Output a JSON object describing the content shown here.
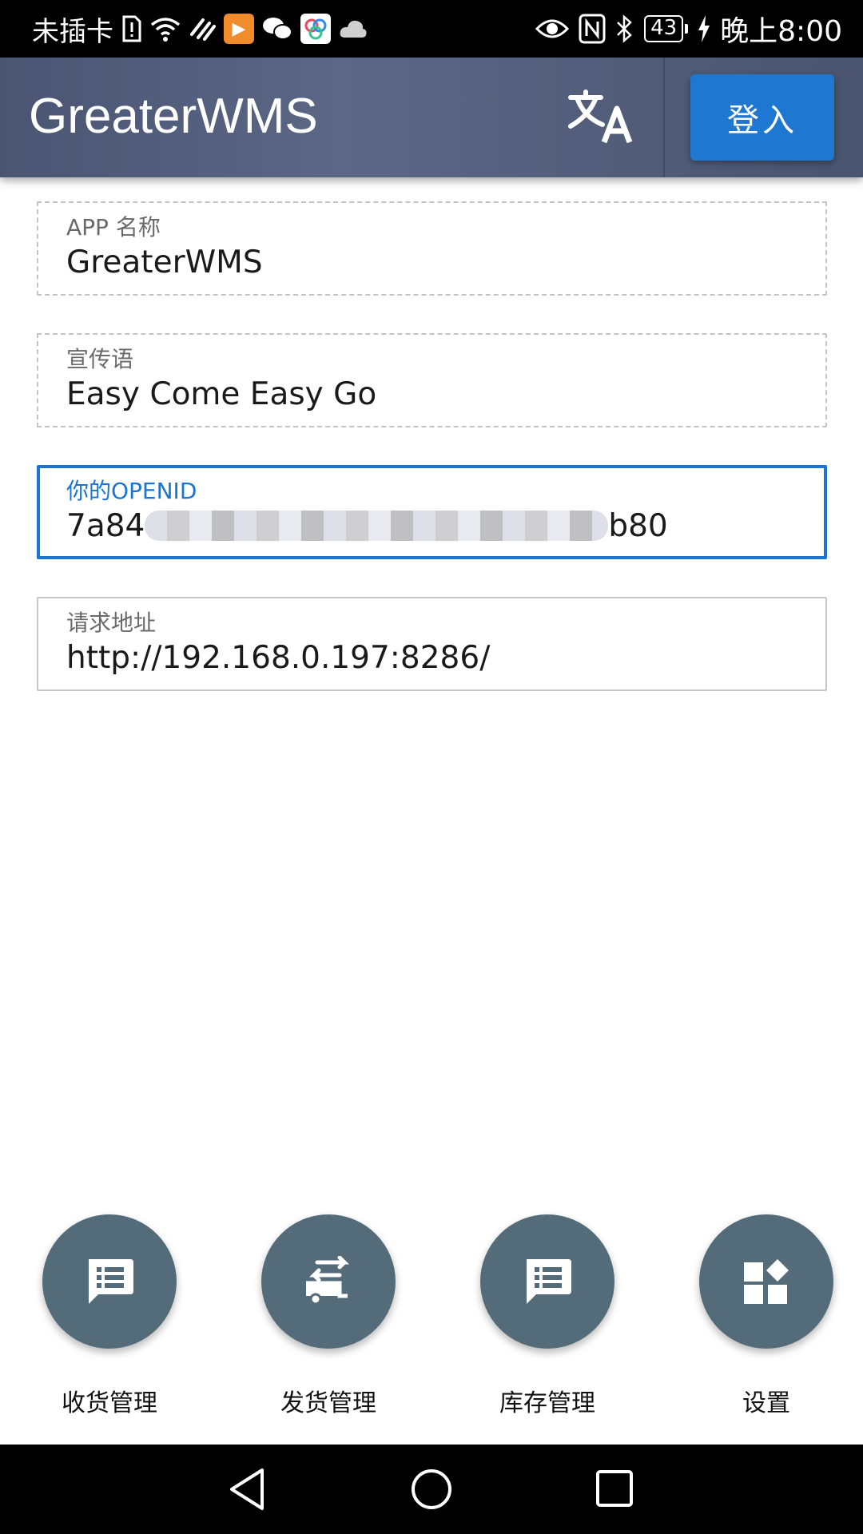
{
  "status_bar": {
    "carrier": "未插卡",
    "battery": "43",
    "time": "晚上8:00",
    "icons": [
      "sim-alert-icon",
      "wifi-icon",
      "nfc-pay-icon",
      "app-notification-icon",
      "wechat-icon",
      "app-icon",
      "cloud-icon",
      "eye-icon",
      "nfc-icon",
      "bluetooth-icon",
      "charging-icon"
    ]
  },
  "header": {
    "title": "GreaterWMS",
    "translate_icon": "translate-icon",
    "login_label": "登入",
    "colors": {
      "header_bg": "#4f5a77",
      "login_bg": "#1e78d2"
    }
  },
  "fields": {
    "app_name": {
      "label": "APP 名称",
      "value": "GreaterWMS"
    },
    "slogan": {
      "label": "宣传语",
      "value": "Easy Come Easy Go"
    },
    "openid": {
      "label": "你的OPENID",
      "value_prefix": "7a84",
      "value_suffix": "b80"
    },
    "request_url": {
      "label": "请求地址",
      "value": "http://192.168.0.197:8286/"
    }
  },
  "bottom_nav": {
    "items": [
      {
        "label": "收货管理",
        "icon": "message-list-icon"
      },
      {
        "label": "发货管理",
        "icon": "rv-swap-icon"
      },
      {
        "label": "库存管理",
        "icon": "message-list-icon"
      },
      {
        "label": "设置",
        "icon": "widgets-icon"
      }
    ],
    "circle_color": "#546c79"
  },
  "system_nav": {
    "icons": [
      "back-icon",
      "home-icon",
      "recents-icon"
    ]
  }
}
